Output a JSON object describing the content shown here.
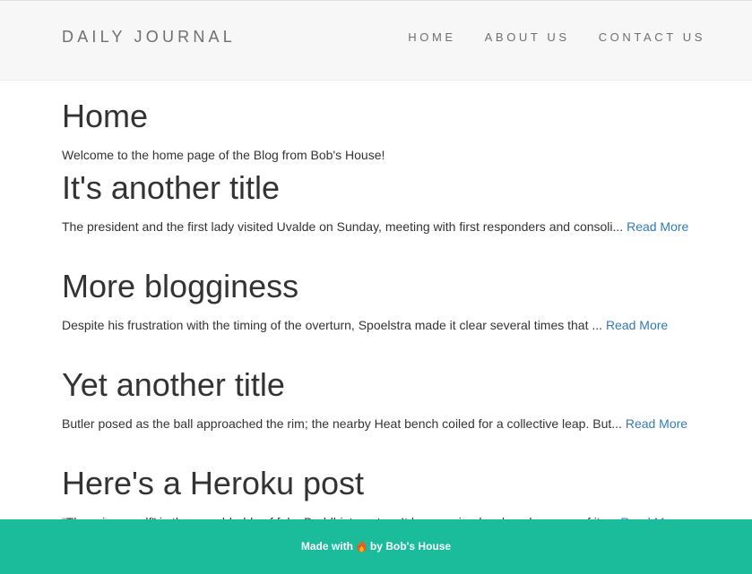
{
  "header": {
    "brand": "DAILY JOURNAL",
    "nav": [
      "HOME",
      "ABOUT US",
      "CONTACT US"
    ]
  },
  "main": {
    "title": "Home",
    "intro": "Welcome to the home page of the Blog from Bob's House!",
    "posts": [
      {
        "title": "It's another title",
        "excerpt": "The president and the first lady visited Uvalde on Sunday, meeting with first responders and consoli... ",
        "link": "Read More"
      },
      {
        "title": "More blogginess",
        "excerpt": "Despite his frustration with the timing of the overturn, Spoelstra made it clear several times that ... ",
        "link": "Read More"
      },
      {
        "title": "Yet another title",
        "excerpt": "Butler posed as the ball approached the rim; the nearby Heat bench coiled for a collective leap. But... ",
        "link": "Read More"
      },
      {
        "title": "Here's a Heroku post",
        "excerpt": "“There is no self” is the granddaddy of fake Buddhist quotes. It has survived so long because of its... ",
        "link": "Read More"
      }
    ]
  },
  "footer": {
    "prefix": "Made with",
    "icon": "fire-icon",
    "suffix": "by Bob's House",
    "background_color": "#1abc9c"
  },
  "colors": {
    "link": "#337ab7",
    "nav_text": "#6f6f6f",
    "header_bg": "#f7f7f7"
  }
}
